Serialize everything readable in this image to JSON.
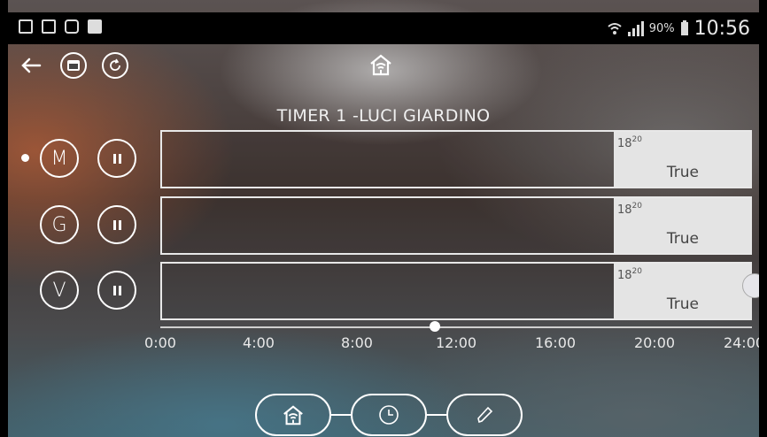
{
  "status_bar": {
    "left_icons": [
      "image-icon",
      "clipboard-icon",
      "s-app-icon",
      "youtube-icon"
    ],
    "battery": "90%",
    "time": "10:56"
  },
  "top_bar": {
    "back_icon": "arrow-left-icon",
    "calendar_icon": "calendar-icon",
    "refresh_icon": "refresh-icon",
    "home_icon": "home-wifi-icon"
  },
  "title": "TIMER 1 -LUCI GIARDINO",
  "rows": [
    {
      "day": "M",
      "selected": true,
      "slot_start_h": "18",
      "slot_start_m": "20",
      "slot_value": "True"
    },
    {
      "day": "G",
      "selected": false,
      "slot_start_h": "18",
      "slot_start_m": "20",
      "slot_value": "True"
    },
    {
      "day": "V",
      "selected": false,
      "slot_start_h": "18",
      "slot_start_m": "20",
      "slot_value": "True"
    }
  ],
  "axis": {
    "ticks": [
      "0:00",
      "4:00",
      "8:00",
      "12:00",
      "16:00",
      "20:00",
      "24:00"
    ]
  },
  "bottom_nav": [
    "home-wifi-icon",
    "clock-icon",
    "pencil-icon"
  ],
  "colors": {
    "slot_bg": "#e4e4e4",
    "line": "#ffffff"
  }
}
